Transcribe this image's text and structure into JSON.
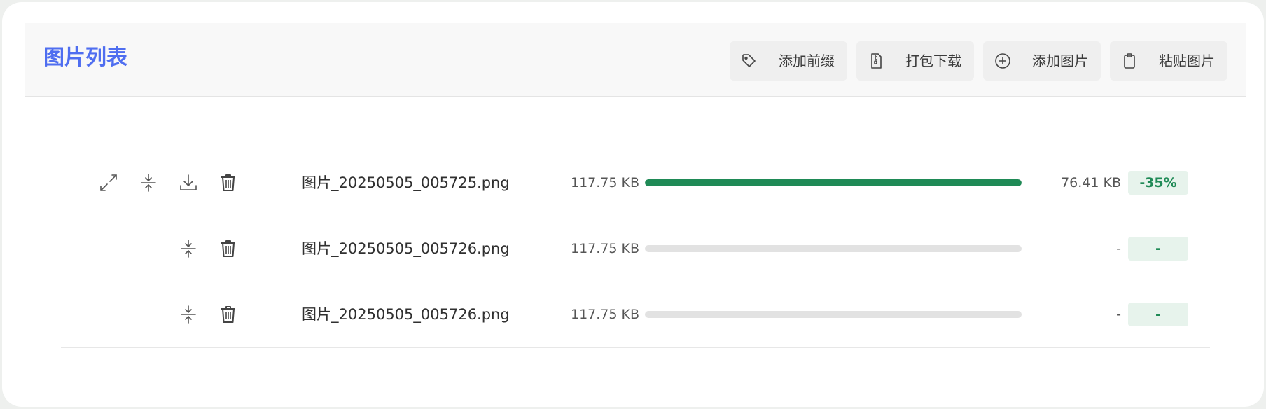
{
  "header": {
    "title": "图片列表",
    "buttons": [
      {
        "label": "添加前缀",
        "icon": "tag-icon"
      },
      {
        "label": "打包下载",
        "icon": "zip-file-icon"
      },
      {
        "label": "添加图片",
        "icon": "plus-circle-icon"
      },
      {
        "label": "粘贴图片",
        "icon": "clipboard-icon"
      }
    ]
  },
  "colors": {
    "accent": "#4f6ef0",
    "success": "#1f8a56",
    "badge_bg": "#e7f3ec",
    "track": "#e2e2e2"
  },
  "rows": [
    {
      "actions": [
        "expand-icon",
        "compress-icon",
        "download-icon",
        "trash-icon"
      ],
      "filename": "图片_20250505_005725.png",
      "original_size": "117.75 KB",
      "progress": 1.0,
      "new_size": "76.41 KB",
      "ratio": "-35%"
    },
    {
      "actions": [
        "compress-icon",
        "trash-icon"
      ],
      "filename": "图片_20250505_005726.png",
      "original_size": "117.75 KB",
      "progress": 0,
      "new_size": "-",
      "ratio": "-"
    },
    {
      "actions": [
        "compress-icon",
        "trash-icon"
      ],
      "filename": "图片_20250505_005726.png",
      "original_size": "117.75 KB",
      "progress": 0,
      "new_size": "-",
      "ratio": "-"
    }
  ]
}
